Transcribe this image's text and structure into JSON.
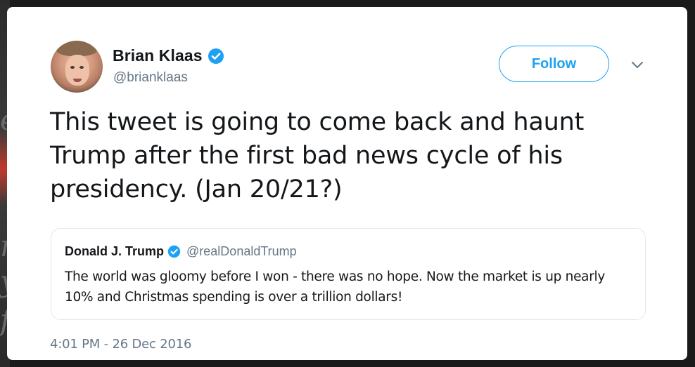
{
  "tweet": {
    "author": {
      "display_name": "Brian Klaas",
      "handle": "@brianklaas",
      "verified": true
    },
    "follow_label": "Follow",
    "text": "This tweet is going to come back and haunt Trump after the first bad news cycle of his presidency. (Jan 20/21?)",
    "timestamp": "4:01 PM - 26 Dec 2016",
    "quoted": {
      "display_name": "Donald J. Trump",
      "handle": "@realDonaldTrump",
      "verified": true,
      "text": "The world was gloomy before I won - there was no hope. Now the market is up nearly 10% and Christmas spending is over a trillion dollars!"
    }
  },
  "icons": {
    "verified": "verified-badge-icon",
    "chevron": "chevron-down-icon"
  },
  "colors": {
    "accent": "#1da1f2",
    "text": "#14171a",
    "muted": "#657786",
    "border": "#e1e8ed"
  }
}
